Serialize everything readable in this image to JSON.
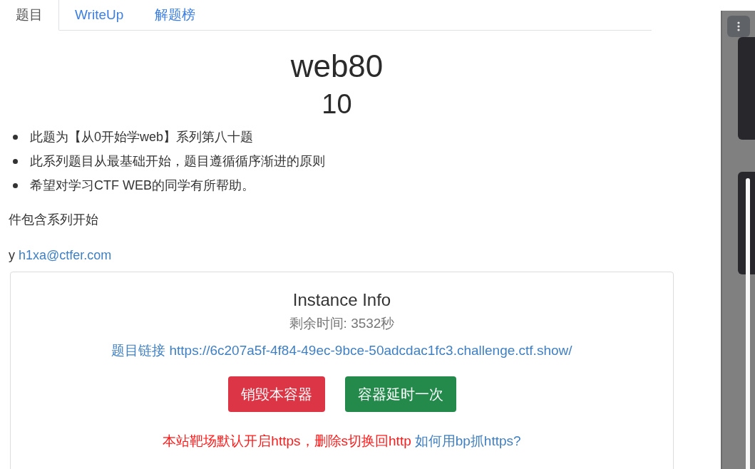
{
  "tabs": [
    {
      "label": "题目",
      "selected": true
    },
    {
      "label": "WriteUp",
      "selected": false
    },
    {
      "label": "解题榜",
      "selected": false
    }
  ],
  "challenge": {
    "title": "web80",
    "points": "10",
    "description": [
      "此题为【从0开始学web】系列第八十题",
      "此系列题目从最基础开始，题目遵循循序渐进的原则",
      "希望对学习CTF WEB的同学有所帮助。"
    ],
    "note": "件包含系列开始",
    "author_prefix": "y",
    "author_email": "h1xa@ctfer.com"
  },
  "instance": {
    "title": "Instance Info",
    "time_remaining": "剩余时间: 3532秒",
    "link_label": "题目链接",
    "link_url": "https://6c207a5f-4f84-49ec-9bce-50adcdac1fc3.challenge.ctf.show/",
    "buttons": [
      {
        "label": "销毁本容器",
        "kind": "danger"
      },
      {
        "label": "容器延时一次",
        "kind": "success"
      }
    ],
    "notice": "本站靶场默认开启https，删除s切换回http",
    "notice_link": "如何用bp抓https?"
  }
}
